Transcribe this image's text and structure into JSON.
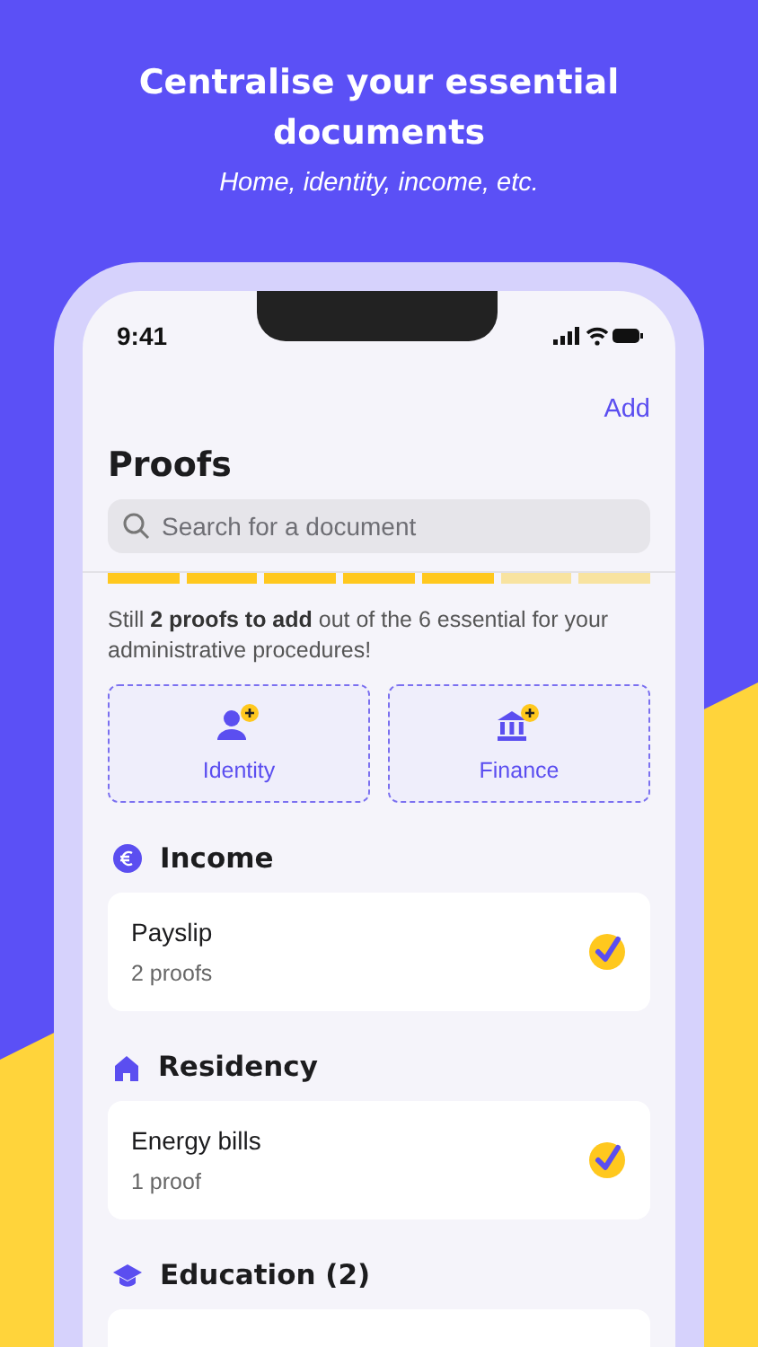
{
  "headline": "Centralise your essential documents",
  "subheadline": "Home, identity, income, etc.",
  "status_bar": {
    "time": "9:41"
  },
  "nav": {
    "action": "Add"
  },
  "title": "Proofs",
  "search": {
    "placeholder": "Search for a document"
  },
  "progress_segments": [
    {
      "filled": true
    },
    {
      "filled": true
    },
    {
      "filled": true
    },
    {
      "filled": true
    },
    {
      "filled": true
    },
    {
      "filled": false
    },
    {
      "filled": false
    }
  ],
  "progress_text": "Still **2 proofs to add** out of the 6 essential for your administrative procedures!",
  "add_tiles": [
    {
      "kind": "person",
      "label": "Identity"
    },
    {
      "kind": "bank",
      "label": "Finance"
    }
  ],
  "sections": [
    {
      "kind": "euro",
      "title": "Income",
      "items": [
        {
          "name": "Payslip",
          "count": "2 proofs",
          "checked": true
        }
      ]
    },
    {
      "kind": "house",
      "title": "Residency",
      "items": [
        {
          "name": "Energy bills",
          "count": "1 proof",
          "checked": true
        }
      ]
    },
    {
      "kind": "graduation",
      "title": "Education (2)"
    }
  ]
}
